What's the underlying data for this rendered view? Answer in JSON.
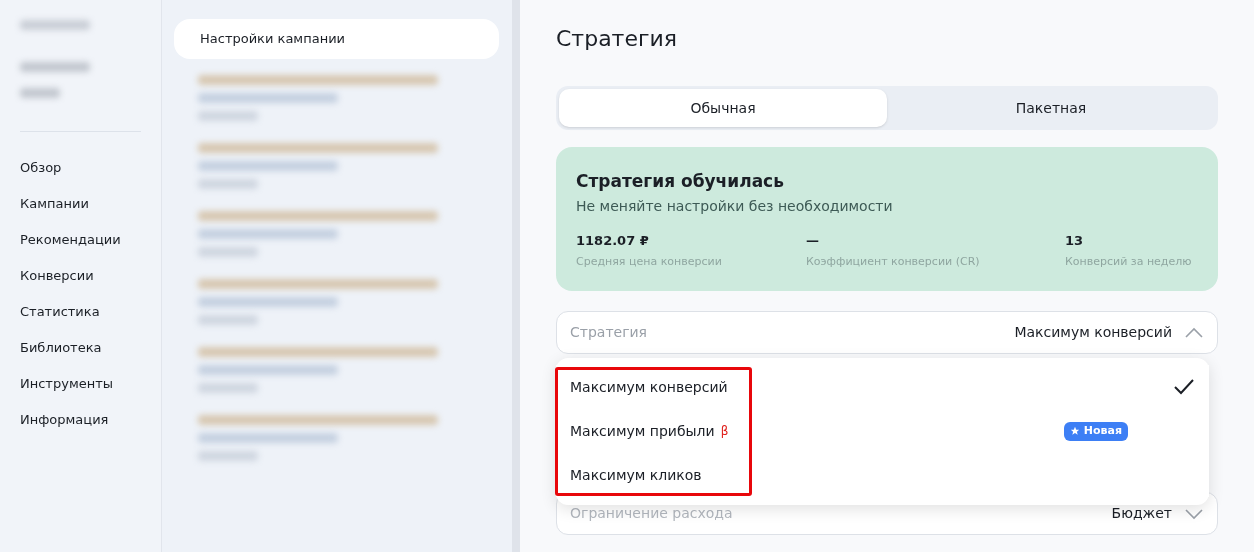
{
  "sidebar": {
    "items": [
      {
        "label": "Обзор"
      },
      {
        "label": "Кампании"
      },
      {
        "label": "Рекомендации"
      },
      {
        "label": "Конверсии"
      },
      {
        "label": "Статистика"
      },
      {
        "label": "Библиотека"
      },
      {
        "label": "Инструменты"
      },
      {
        "label": "Информация"
      }
    ]
  },
  "campaign_nav": {
    "active_item": "Настройки кампании"
  },
  "panel": {
    "title": "Стратегия",
    "tabs": [
      {
        "label": "Обычная",
        "selected": true
      },
      {
        "label": "Пакетная",
        "selected": false
      }
    ],
    "status_card": {
      "title": "Стратегия обучилась",
      "subtitle": "Не меняйте настройки без необходимости",
      "metrics": [
        {
          "value": "1182.07 ₽",
          "label": "Средняя цена конверсии"
        },
        {
          "value": "—",
          "label": "Коэффициент конверсии (CR)"
        },
        {
          "value": "13",
          "label": "Конверсий за неделю"
        }
      ]
    },
    "strategy_select": {
      "label": "Стратегия",
      "value": "Максимум конверсий",
      "expanded": true
    },
    "options": [
      {
        "label": "Максимум конверсий",
        "selected": true
      },
      {
        "label": "Максимум прибыли",
        "suffix": "β",
        "badge": "Новая",
        "selected": false
      },
      {
        "label": "Максимум кликов",
        "selected": false
      }
    ],
    "limit_select": {
      "label": "Ограничение расхода",
      "value": "Бюджет",
      "expanded": false
    }
  }
}
